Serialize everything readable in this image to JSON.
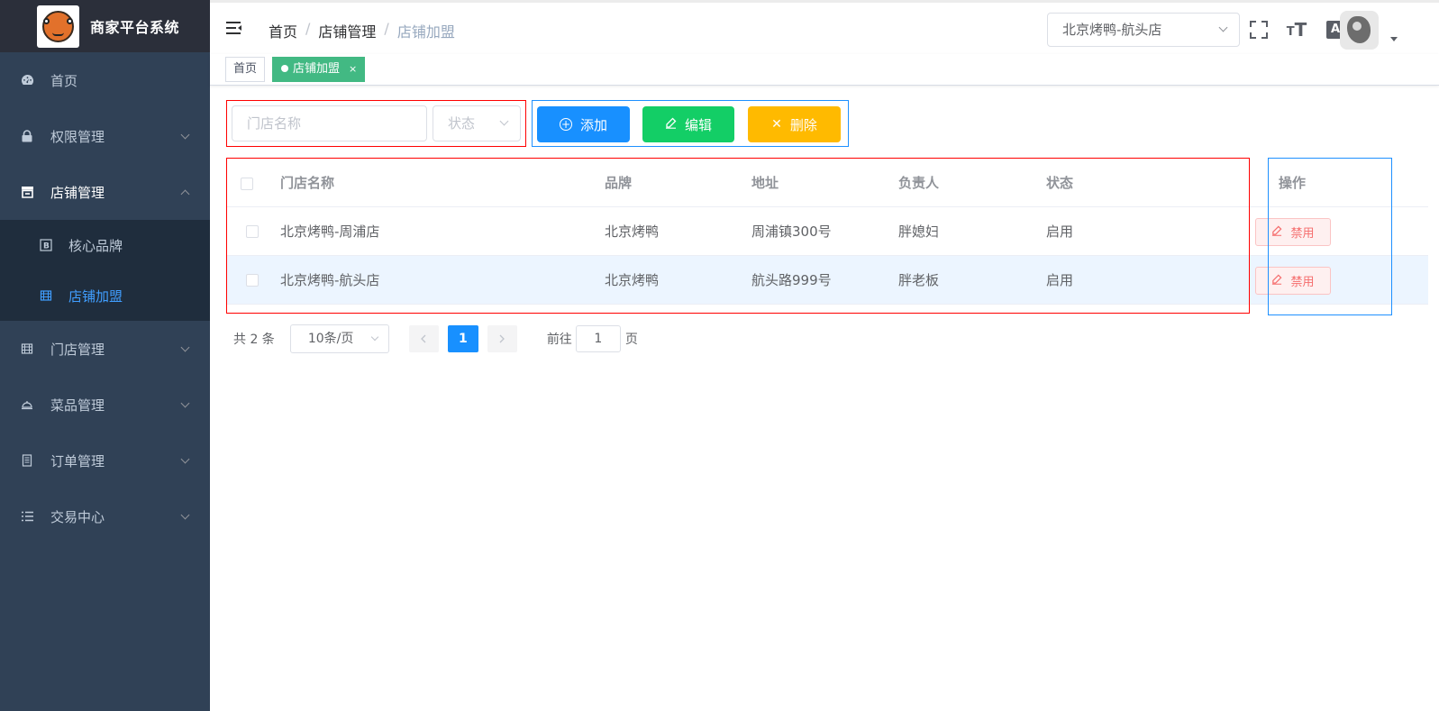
{
  "app": {
    "title": "商家平台系统"
  },
  "sidebar": {
    "items": [
      {
        "label": "首页",
        "icon": "dashboard-icon"
      },
      {
        "label": "权限管理",
        "icon": "lock-icon"
      },
      {
        "label": "店铺管理",
        "icon": "shop-icon"
      },
      {
        "label": "门店管理",
        "icon": "building-icon"
      },
      {
        "label": "菜品管理",
        "icon": "dish-cover-icon"
      },
      {
        "label": "订单管理",
        "icon": "document-icon"
      },
      {
        "label": "交易中心",
        "icon": "list-icon"
      }
    ],
    "submenu": [
      {
        "label": "核心品牌",
        "icon": "brand-icon"
      },
      {
        "label": "店铺加盟",
        "icon": "franchise-icon"
      }
    ]
  },
  "header": {
    "breadcrumb": [
      "首页",
      "店铺管理",
      "店铺加盟"
    ],
    "breadcrumb_sep": "/",
    "store_selected": "北京烤鸭-航头店",
    "lang_glyph": "A"
  },
  "tags": {
    "home": "首页",
    "active": "店铺加盟",
    "close": "×"
  },
  "filters": {
    "name_placeholder": "门店名称",
    "status_placeholder": "状态"
  },
  "toolbar": {
    "add": "添加",
    "edit": "编辑",
    "delete": "删除"
  },
  "table": {
    "columns": [
      "门店名称",
      "品牌",
      "地址",
      "负责人",
      "状态",
      "操作"
    ],
    "rows": [
      {
        "name": "北京烤鸭-周浦店",
        "brand": "北京烤鸭",
        "address": "周浦镇300号",
        "owner": "胖媳妇",
        "status": "启用",
        "action": "禁用"
      },
      {
        "name": "北京烤鸭-航头店",
        "brand": "北京烤鸭",
        "address": "航头路999号",
        "owner": "胖老板",
        "status": "启用",
        "action": "禁用"
      }
    ]
  },
  "pagination": {
    "total_text": "共 2 条",
    "page_size": "10条/页",
    "current_page": "1",
    "jump_prefix": "前往",
    "jump_value": "1",
    "jump_suffix": "页"
  },
  "colors": {
    "sidebar_bg": "#304156",
    "active_menu": "#409eff",
    "tag_active": "#42b983",
    "btn_add": "#1890ff",
    "btn_edit": "#13ce66",
    "btn_delete": "#ffba00",
    "btn_disable": "#f56c6c"
  }
}
